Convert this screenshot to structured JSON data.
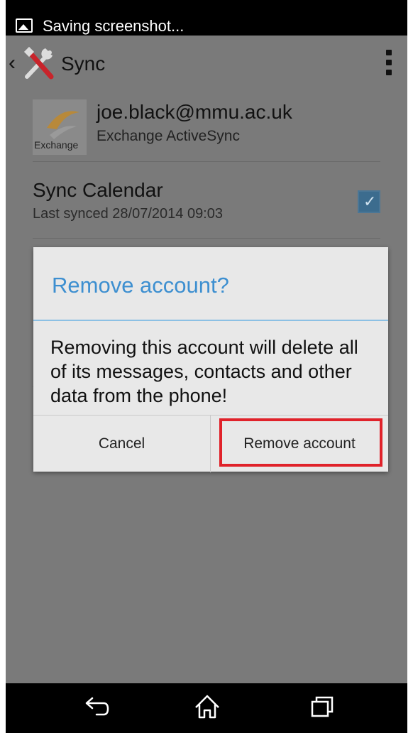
{
  "status_bar": {
    "notification_icon": "image-icon",
    "notification_text": "Saving screenshot..."
  },
  "action_bar": {
    "back_icon": "chevron-left-icon",
    "app_icon": "tools-icon",
    "title": "Sync",
    "overflow_icon": "overflow-menu-icon"
  },
  "account": {
    "logo_icon": "exchange-logo-icon",
    "logo_label": "Exchange",
    "email": "joe.black@mmu.ac.uk",
    "type": "Exchange ActiveSync"
  },
  "sync_calendar": {
    "title": "Sync Calendar",
    "last_synced": "Last synced 28/07/2014 09:03",
    "checked": true
  },
  "dialog": {
    "title": "Remove account?",
    "message": "Removing this account will delete all of its messages, contacts and other data from the phone!",
    "cancel_label": "Cancel",
    "confirm_label": "Remove account"
  },
  "nav_bar": {
    "back_icon": "back-arrow-icon",
    "home_icon": "home-icon",
    "recent_icon": "recent-apps-icon"
  },
  "colors": {
    "dialog_title": "#3d8fd0",
    "highlight": "#e0222a",
    "checkbox": "#3c6c8e",
    "dimmed_background": "#7a7a7a"
  }
}
